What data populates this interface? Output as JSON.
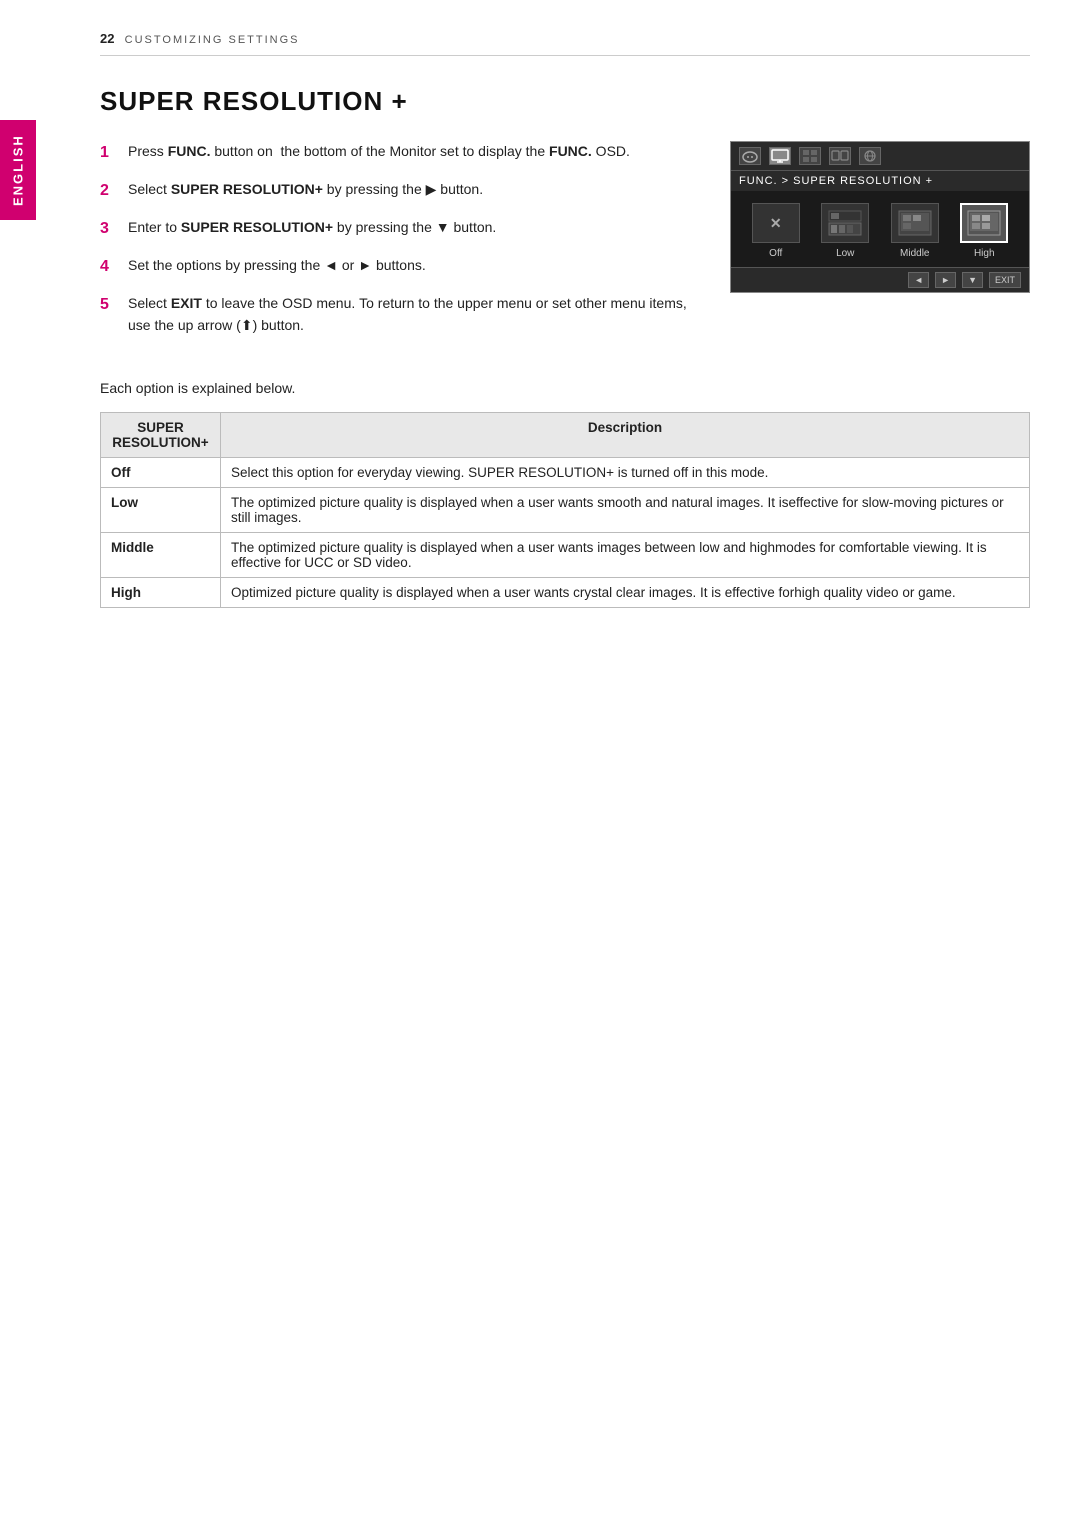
{
  "header": {
    "page_number": "22",
    "section_label": "CUSTOMIZING SETTINGS"
  },
  "sidebar": {
    "language_label": "ENGLISH"
  },
  "section": {
    "title": "SUPER RESOLUTION +",
    "steps": [
      {
        "number": "1",
        "text": "Press FUNC. button on  the bottom of the Monitor set to display the FUNC. OSD.",
        "bold_words": [
          "FUNC.",
          "FUNC."
        ]
      },
      {
        "number": "2",
        "text": "Select SUPER RESOLUTION+ by pressing the ▶ button.",
        "bold_words": [
          "SUPER RESOLUTION+"
        ]
      },
      {
        "number": "3",
        "text": "Enter to SUPER RESOLUTION+ by pressing the ▼ button.",
        "bold_words": [
          "SUPER RESOLUTION+"
        ]
      },
      {
        "number": "4",
        "text": "Set the options by pressing the ◄ or ► buttons."
      },
      {
        "number": "5",
        "text": "Select EXIT to leave the OSD menu. To return to the upper menu or set other menu items, use the up arrow (↑) button.",
        "bold_words": [
          "EXIT"
        ]
      }
    ],
    "osd": {
      "label": "FUNC. > SUPER RESOLUTION +",
      "options": [
        "Off",
        "Low",
        "Middle",
        "High"
      ],
      "selected_index": 3,
      "nav_buttons": [
        "◄",
        "►",
        "▼",
        "EXIT"
      ]
    },
    "each_option_label": "Each option is explained below.",
    "table": {
      "col1_header": "SUPER\nRESOLUTION+",
      "col2_header": "Description",
      "rows": [
        {
          "option": "Off",
          "description": "Select this option for everyday viewing. SUPER RESOLUTION+  is turned off in this mode."
        },
        {
          "option": "Low",
          "description": "The optimized picture quality is displayed when a user wants smooth and natural images. It iseffective for slow-moving pictures or still images."
        },
        {
          "option": "Middle",
          "description": "The optimized picture quality is displayed when a user wants images between low and highmodes for comfortable viewing. It is effective for UCC or SD video."
        },
        {
          "option": "High",
          "description": "Optimized picture quality is displayed when a user wants crystal clear images. It is effective forhigh quality video or game."
        }
      ]
    }
  }
}
